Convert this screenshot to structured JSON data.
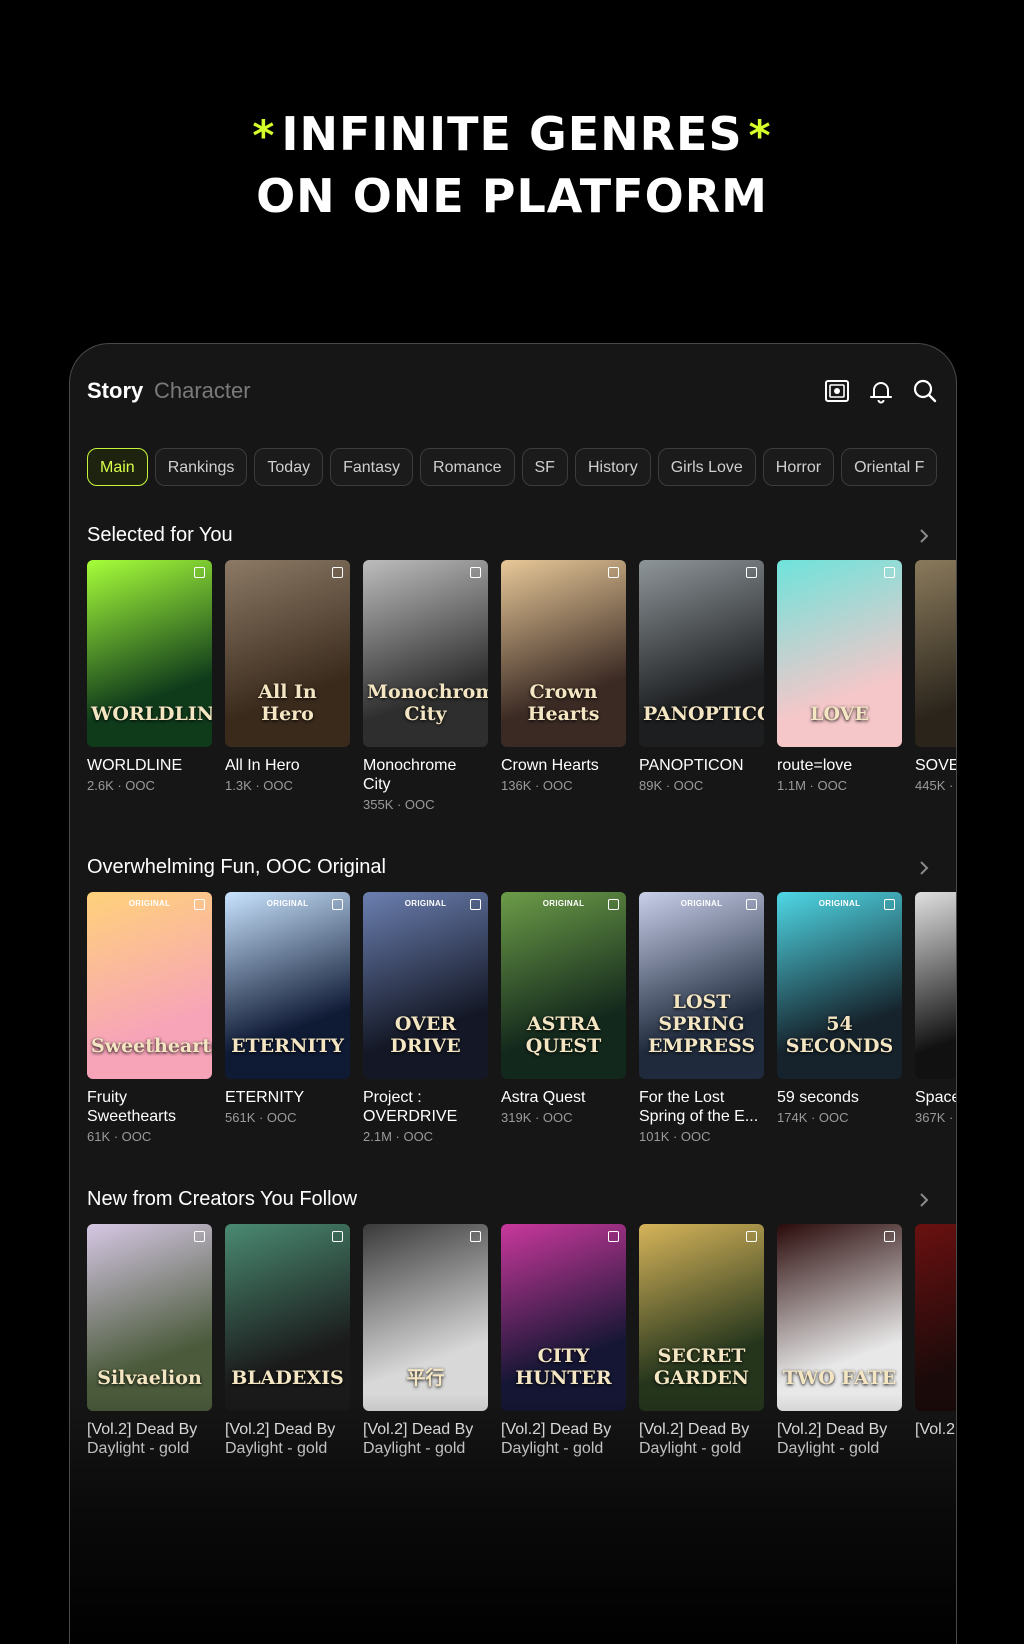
{
  "headline": {
    "star": "*",
    "line1": "INFINITE GENRES",
    "line2": "ON ONE PLATFORM"
  },
  "topbar": {
    "story": "Story",
    "character": "Character",
    "icons": [
      "gallery-icon",
      "bell-icon",
      "search-icon"
    ]
  },
  "chips": [
    "Main",
    "Rankings",
    "Today",
    "Fantasy",
    "Romance",
    "SF",
    "History",
    "Girls Love",
    "Horror",
    "Oriental F"
  ],
  "sections": [
    {
      "title": "Selected for You",
      "cards": [
        {
          "title": "WORLDLINE",
          "meta": "2.6K · OOC",
          "cover_text": "WORLDLINE",
          "c1": "#0f3b1b",
          "c2": "#a7ff3a"
        },
        {
          "title": "All In Hero",
          "meta": "1.3K · OOC",
          "cover_text": "All In Hero",
          "c1": "#3a2a1c",
          "c2": "#8c7a66"
        },
        {
          "title": "Monochrome City",
          "meta": "355K · OOC",
          "cover_text": "Monochrome City",
          "c1": "#2e2e2e",
          "c2": "#bdbdbd"
        },
        {
          "title": "Crown Hearts",
          "meta": "136K · OOC",
          "cover_text": "Crown Hearts",
          "c1": "#3b2a24",
          "c2": "#e7c898"
        },
        {
          "title": "PANOPTICON",
          "meta": "89K · OOC",
          "cover_text": "PANOPTICON",
          "c1": "#1c1e20",
          "c2": "#8e9599"
        },
        {
          "title": "route=love",
          "meta": "1.1M · OOC",
          "cover_text": "LOVE",
          "c1": "#f5c7c9",
          "c2": "#6ee3db"
        },
        {
          "title": "SOVE",
          "meta": "445K ·",
          "cover_text": "",
          "c1": "#2a241b",
          "c2": "#8a7a5c"
        }
      ]
    },
    {
      "title": "Overwhelming Fun, OOC Original",
      "cards": [
        {
          "title": "Fruity Sweethearts",
          "meta": "61K · OOC",
          "cover_text": "Sweethearts",
          "c1": "#f7a4b8",
          "c2": "#ffd27a",
          "original": "ORIGINAL"
        },
        {
          "title": "ETERNITY",
          "meta": "561K · OOC",
          "cover_text": "ETERNITY",
          "c1": "#0f1a35",
          "c2": "#c9e4ff",
          "original": "ORIGINAL"
        },
        {
          "title": "Project : OVERDRIVE",
          "meta": "2.1M · OOC",
          "cover_text": "OVER DRIVE",
          "c1": "#141826",
          "c2": "#6b7fb0",
          "original": "ORIGINAL"
        },
        {
          "title": "Astra Quest",
          "meta": "319K · OOC",
          "cover_text": "ASTRA QUEST",
          "c1": "#13281c",
          "c2": "#6c9c48",
          "original": "ORIGINAL"
        },
        {
          "title": "For the Lost Spring of the E...",
          "meta": "101K · OOC",
          "cover_text": "LOST SPRING EMPRESS",
          "c1": "#1f2a3c",
          "c2": "#c8d0ea",
          "original": "ORIGINAL"
        },
        {
          "title": "59 seconds",
          "meta": "174K · OOC",
          "cover_text": "54 SECONDS",
          "c1": "#16232c",
          "c2": "#4fd8e6",
          "original": "ORIGINAL"
        },
        {
          "title": "Space",
          "meta": "367K ·",
          "cover_text": "",
          "c1": "#111",
          "c2": "#e0e0e0"
        }
      ]
    },
    {
      "title": "New from Creators You Follow",
      "cards": [
        {
          "title": "[Vol.2] Dead By Daylight - gold",
          "meta": "",
          "cover_text": "Silvaelion",
          "c1": "#4a5a3a",
          "c2": "#d6c7e4"
        },
        {
          "title": "[Vol.2] Dead By Daylight - gold",
          "meta": "",
          "cover_text": "BLADEXIS",
          "c1": "#1a1a1a",
          "c2": "#4a8a72"
        },
        {
          "title": "[Vol.2] Dead By Daylight - gold",
          "meta": "",
          "cover_text": "平行",
          "c1": "#d8d8d8",
          "c2": "#3a3a3a"
        },
        {
          "title": "[Vol.2] Dead By Daylight - gold",
          "meta": "",
          "cover_text": "CITY HUNTER",
          "c1": "#141633",
          "c2": "#c9389c"
        },
        {
          "title": "[Vol.2] Dead By Daylight - gold",
          "meta": "",
          "cover_text": "SECRET GARDEN",
          "c1": "#24351c",
          "c2": "#d6b45a"
        },
        {
          "title": "[Vol.2] Dead By Daylight - gold",
          "meta": "",
          "cover_text": "TWO FATE",
          "c1": "#e8e8e8",
          "c2": "#2a0a0a"
        },
        {
          "title": "[Vol.2",
          "meta": "",
          "cover_text": "",
          "c1": "#1a0a0a",
          "c2": "#6a1010"
        }
      ]
    }
  ]
}
